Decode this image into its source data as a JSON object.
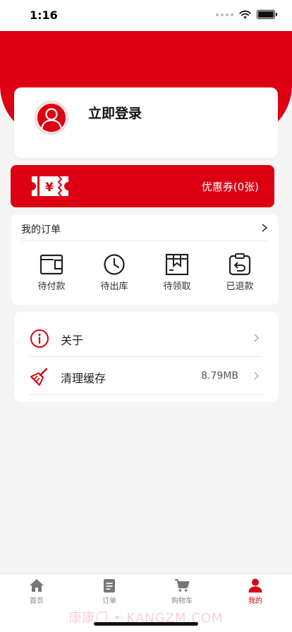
{
  "status_bar": {
    "time": "1:16"
  },
  "profile": {
    "login_label": "立即登录"
  },
  "coupon": {
    "label": "优惠券(0张)",
    "icon": "coupon-ticket-icon"
  },
  "orders": {
    "title": "我的订单",
    "items": [
      {
        "label": "待付款",
        "icon": "wallet-icon"
      },
      {
        "label": "待出库",
        "icon": "clock-icon"
      },
      {
        "label": "待领取",
        "icon": "package-icon"
      },
      {
        "label": "已退款",
        "icon": "refund-icon"
      }
    ]
  },
  "menu": {
    "items": [
      {
        "label": "关于",
        "value": "",
        "icon": "info-icon"
      },
      {
        "label": "清理缓存",
        "value": "8.79MB",
        "icon": "broom-icon"
      }
    ]
  },
  "tabs": [
    {
      "label": "首页",
      "icon": "home-icon",
      "active": false
    },
    {
      "label": "订单",
      "icon": "clipboard-icon",
      "active": false
    },
    {
      "label": "购物车",
      "icon": "cart-icon",
      "active": false
    },
    {
      "label": "我的",
      "icon": "user-icon",
      "active": true
    }
  ],
  "watermark": "康康门 • KANGZM.COM",
  "colors": {
    "brand_red": "#dc0012",
    "background": "#f5f5f5",
    "active_tab": "#dc0012"
  }
}
